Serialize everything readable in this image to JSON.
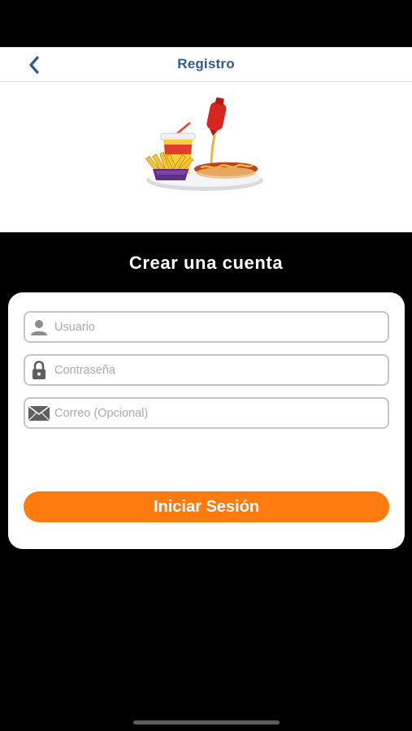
{
  "header": {
    "title": "Registro",
    "back_icon": "chevron-left-icon",
    "accent_color": "#2f5a8f"
  },
  "hero": {
    "illustration": "fast-food-illustration"
  },
  "page": {
    "title": "Crear una cuenta"
  },
  "form": {
    "fields": [
      {
        "icon": "user-icon",
        "value": "",
        "placeholder": "Usuario"
      },
      {
        "icon": "lock-icon",
        "value": "",
        "placeholder": "Contraseña"
      },
      {
        "icon": "mail-icon",
        "value": "",
        "placeholder": "Correo (Opcional)"
      }
    ],
    "submit_label": "Iniciar Sesión",
    "submit_color": "#ff7a0f"
  }
}
